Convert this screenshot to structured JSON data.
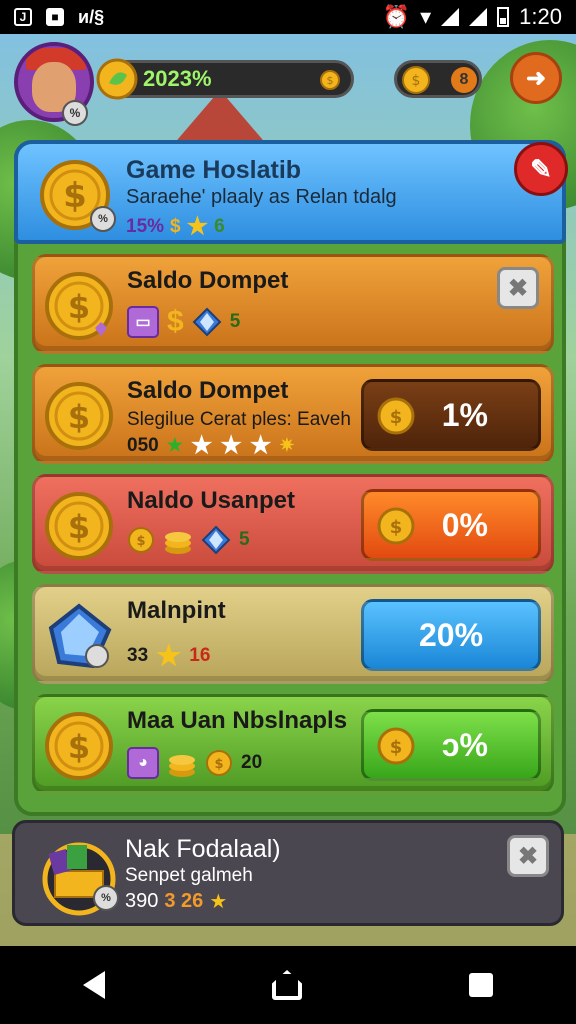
{
  "status_bar": {
    "time": "1:20"
  },
  "hud": {
    "xp_value": "2023%",
    "currency_badge": "8"
  },
  "header": {
    "title": "Game Hoslatib",
    "subtitle": "Saraehe' plaaly as Relan tdalg",
    "stat_percent": "15%",
    "stat_count": "6"
  },
  "rows": [
    {
      "title": "Saldo Dompet",
      "subtitle": "",
      "meta_value": "5",
      "button": null,
      "color": "orange"
    },
    {
      "title": "Saldo Dompet",
      "subtitle": "Slegilue Cerat ples: Eaveh",
      "meta_value": "050",
      "button": "1%",
      "color": "orange"
    },
    {
      "title": "Naldo Usanpet",
      "subtitle": "",
      "meta_value": "5",
      "button": "0%",
      "color": "red"
    },
    {
      "title": "Malnpint",
      "subtitle": "",
      "meta_value_1": "33",
      "meta_value_2": "16",
      "button": "20%",
      "color": "tan"
    },
    {
      "title": "Maa Uan Nbslnapls",
      "subtitle": "",
      "meta_value": "20",
      "button": "ↄ%",
      "color": "green"
    }
  ],
  "bottom_card": {
    "title": "Nak Fodalaal)",
    "subtitle": "Senpet galmeh",
    "meta_value_1": "390",
    "meta_value_2": "3 26"
  },
  "colors": {
    "accent_blue": "#2e8ee0",
    "panel_green": "#5aa33a",
    "coin_gold": "#f2b51e"
  },
  "icons": [
    "gold-coin-icon",
    "gem-icon",
    "star-icon",
    "close-icon",
    "edit-icon",
    "exit-icon",
    "coin-stack-icon"
  ]
}
